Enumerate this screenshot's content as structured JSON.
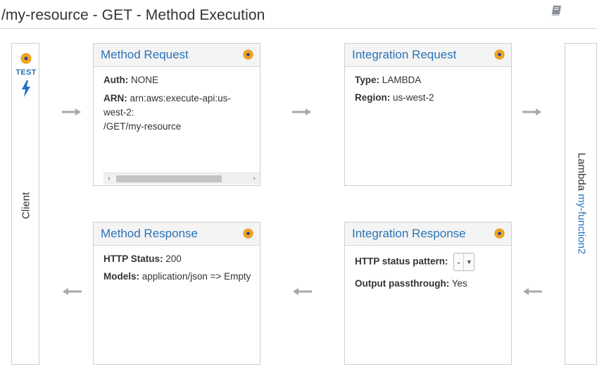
{
  "page": {
    "title": "/my-resource - GET - Method Execution"
  },
  "icons": {
    "book": "book-icon",
    "status_dot": "status-dot-icon",
    "bolt": "lightning-bolt-icon",
    "arrow_right": "arrow-right-icon",
    "arrow_left": "arrow-left-icon"
  },
  "colors": {
    "link_blue": "#2a73b8",
    "dot_orange": "#f5a623",
    "dot_core": "#2d4f8a",
    "arrow_grey": "#a8a8a8"
  },
  "client": {
    "test_label": "TEST",
    "label": "Client"
  },
  "lambda": {
    "prefix": "Lambda",
    "function_name": "my-function2"
  },
  "method_request": {
    "title": "Method Request",
    "auth_label": "Auth:",
    "auth_value": "NONE",
    "arn_label": "ARN:",
    "arn_value_line1": "arn:aws:execute-api:us-",
    "arn_value_line2": "west-2:",
    "arn_value_line3": "/GET/my-resource",
    "scroll_left": "‹",
    "scroll_right": "›"
  },
  "integration_request": {
    "title": "Integration Request",
    "type_label": "Type:",
    "type_value": "LAMBDA",
    "region_label": "Region:",
    "region_value": "us-west-2"
  },
  "method_response": {
    "title": "Method Response",
    "status_label": "HTTP Status:",
    "status_value": "200",
    "models_label": "Models:",
    "models_value": "application/json => Empty"
  },
  "integration_response": {
    "title": "Integration Response",
    "pattern_label": "HTTP status pattern:",
    "pattern_selected": "-",
    "passthrough_label": "Output passthrough:",
    "passthrough_value": "Yes"
  }
}
